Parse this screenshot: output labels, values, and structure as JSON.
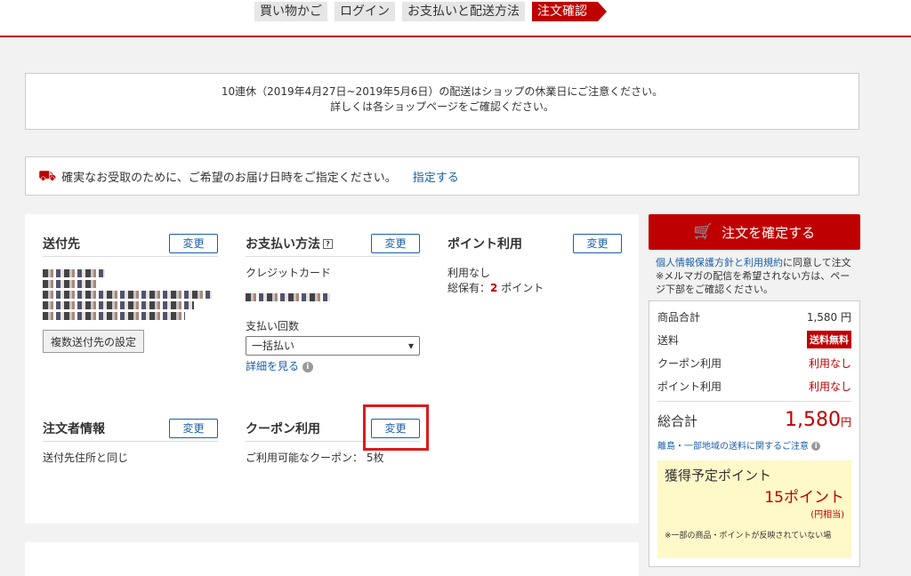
{
  "steps": [
    "買い物かご",
    "ログイン",
    "お支払いと配送方法",
    "注文確認"
  ],
  "notice": {
    "line1": "10連休（2019年4月27日~2019年5月6日）の配送はショップの休業日にご注意ください。",
    "line2": "詳しくは各ショップページをご確認ください。"
  },
  "delivery": {
    "text": "確実なお受取のために、ご希望のお届け日時をご指定ください。",
    "link": "指定する",
    "icon": "truck-icon"
  },
  "shipping": {
    "title": "送付先",
    "change": "変更",
    "multi_button": "複数送付先の設定"
  },
  "payment": {
    "title": "お支払い方法",
    "change": "変更",
    "method": "クレジットカード",
    "installments_label": "支払い回数",
    "installments_value": "一括払い",
    "details_link": "詳細を見る"
  },
  "points": {
    "title": "ポイント利用",
    "change": "変更",
    "usage": "利用なし",
    "held_prefix": "総保有：",
    "held_value": "2",
    "held_suffix": " ポイント"
  },
  "orderer": {
    "title": "注文者情報",
    "change": "変更",
    "value": "送付先住所と同じ"
  },
  "coupon": {
    "title": "クーポン利用",
    "change": "変更",
    "available": "ご利用可能なクーポン： 5枚"
  },
  "sidebar": {
    "confirm": "注文を確定する",
    "agree_link": "個人情報保護方針と利用規約",
    "agree_text": "に同意して注文",
    "mail_note": "※メルマガの配信を希望されない方は、ページ下部をご確認ください。",
    "rows": [
      {
        "label": "商品合計",
        "value": "1,580 円"
      },
      {
        "label": "送料",
        "value": "送料無料"
      },
      {
        "label": "クーポン利用",
        "value": "利用なし"
      },
      {
        "label": "ポイント利用",
        "value": "利用なし"
      }
    ],
    "total_label": "総合計",
    "total_value": "1,580",
    "total_unit": "円",
    "remote_note": "離島・一部地域の送料に関するご注意",
    "earn_title": "獲得予定ポイント",
    "earn_value": "15ポイント",
    "earn_sub": "(円相当)",
    "earn_note": "※一部の商品・ポイントが反映されていない場"
  },
  "colors": {
    "accent": "#bf0000",
    "link": "#1a5faa",
    "highlight": "#d91c1c"
  }
}
